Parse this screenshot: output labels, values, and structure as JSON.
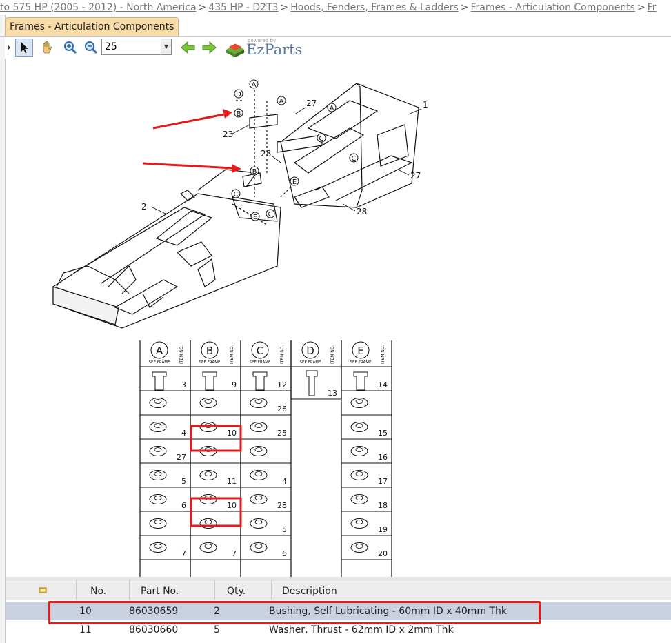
{
  "breadcrumb": {
    "items": [
      "to 575 HP (2005 - 2012) - North America",
      "435 HP - D2T3",
      "Hoods, Fenders, Frames & Ladders",
      "Frames - Articulation Components",
      "Fr"
    ],
    "separator": ">"
  },
  "tab": {
    "label": "Frames - Articulation Components"
  },
  "toolbar": {
    "zoom_value": "25",
    "logo_powered": "powered by",
    "logo_name": "EzParts"
  },
  "drawing": {
    "callouts": [
      "A",
      "A",
      "A",
      "D",
      "B",
      "B",
      "C",
      "C",
      "C",
      "E",
      "E",
      "C"
    ],
    "item_numbers": [
      "27",
      "1",
      "23",
      "28",
      "27",
      "2",
      "28"
    ],
    "legend": {
      "columns": [
        {
          "letter": "A",
          "sub": "SEE FRAME",
          "items": [
            "3",
            "",
            "4",
            "27",
            "5",
            "6",
            "",
            "7"
          ]
        },
        {
          "letter": "B",
          "sub": "SEE FRAME",
          "items": [
            "9",
            "",
            "10",
            "",
            "11",
            "10",
            "",
            "7"
          ]
        },
        {
          "letter": "C",
          "sub": "SEE FRAME",
          "items": [
            "12",
            "26",
            "25",
            "",
            "4",
            "28",
            "5",
            "6"
          ]
        },
        {
          "letter": "D",
          "sub": "SEE FRAME",
          "items": [
            "13"
          ]
        },
        {
          "letter": "E",
          "sub": "SEE FRAME",
          "items": [
            "14",
            "",
            "15",
            "16",
            "17",
            "18",
            "19",
            "20"
          ]
        }
      ],
      "item_no_label": "ITEM NO."
    }
  },
  "grid": {
    "columns": [
      "No.",
      "Part No.",
      "Qty.",
      "Description"
    ],
    "rows": [
      {
        "no": "10",
        "part": "86030659",
        "qty": "2",
        "desc": "Bushing, Self Lubricating - 60mm ID x 40mm Thk"
      },
      {
        "no": "11",
        "part": "86030660",
        "qty": "5",
        "desc": "Washer, Thrust - 62mm ID x 2mm Thk"
      }
    ]
  },
  "colors": {
    "highlight": "#e31b1b",
    "selected_row": "#c9d1e1",
    "tab": "#f8dca8"
  }
}
